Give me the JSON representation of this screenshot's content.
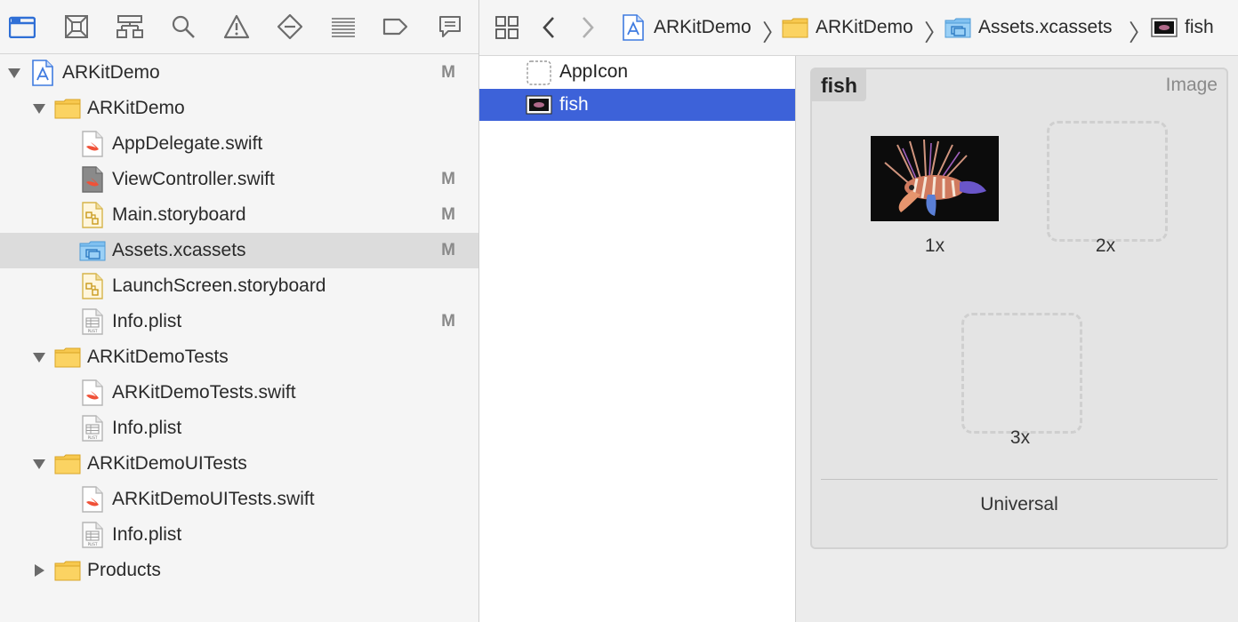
{
  "navigator": {
    "toolbar_icons": [
      "folder-icon",
      "source-control-icon",
      "hierarchy-icon",
      "search-icon",
      "warning-icon",
      "test-icon",
      "debug-icon",
      "breakpoint-icon",
      "report-icon"
    ],
    "items": [
      {
        "label": "ARKitDemo",
        "badge": "M",
        "icon": "project-icon"
      },
      {
        "label": "ARKitDemo",
        "badge": "",
        "icon": "folder-icon"
      },
      {
        "label": "AppDelegate.swift",
        "badge": "",
        "icon": "swift-file-icon"
      },
      {
        "label": "ViewController.swift",
        "badge": "M",
        "icon": "swift-file-icon"
      },
      {
        "label": "Main.storyboard",
        "badge": "M",
        "icon": "storyboard-file-icon"
      },
      {
        "label": "Assets.xcassets",
        "badge": "M",
        "icon": "asset-catalog-icon"
      },
      {
        "label": "LaunchScreen.storyboard",
        "badge": "",
        "icon": "storyboard-file-icon"
      },
      {
        "label": "Info.plist",
        "badge": "M",
        "icon": "plist-file-icon"
      },
      {
        "label": "ARKitDemoTests",
        "badge": "",
        "icon": "folder-icon"
      },
      {
        "label": "ARKitDemoTests.swift",
        "badge": "",
        "icon": "swift-file-icon"
      },
      {
        "label": "Info.plist",
        "badge": "",
        "icon": "plist-file-icon"
      },
      {
        "label": "ARKitDemoUITests",
        "badge": "",
        "icon": "folder-icon"
      },
      {
        "label": "ARKitDemoUITests.swift",
        "badge": "",
        "icon": "swift-file-icon"
      },
      {
        "label": "Info.plist",
        "badge": "",
        "icon": "plist-file-icon"
      },
      {
        "label": "Products",
        "badge": "",
        "icon": "folder-icon"
      }
    ]
  },
  "jumpbar": {
    "crumbs": [
      {
        "label": "ARKitDemo",
        "icon": "project-icon"
      },
      {
        "label": "ARKitDemo",
        "icon": "folder-icon"
      },
      {
        "label": "Assets.xcassets",
        "icon": "asset-catalog-icon"
      },
      {
        "label": "fish",
        "icon": "image-thumbnail-icon"
      }
    ]
  },
  "asset_list": {
    "items": [
      {
        "label": "AppIcon",
        "selected": false
      },
      {
        "label": "fish",
        "selected": true
      }
    ]
  },
  "image_set": {
    "name": "fish",
    "type": "Image",
    "slots": [
      {
        "label": "1x",
        "filled": true
      },
      {
        "label": "2x",
        "filled": false
      },
      {
        "label": "3x",
        "filled": false
      }
    ],
    "idiom": "Universal"
  },
  "colors": {
    "selection": "#3d62d9",
    "folder": "#f5c242",
    "accent_blue": "#2f6fd6",
    "badge": "#8a8a8a"
  }
}
